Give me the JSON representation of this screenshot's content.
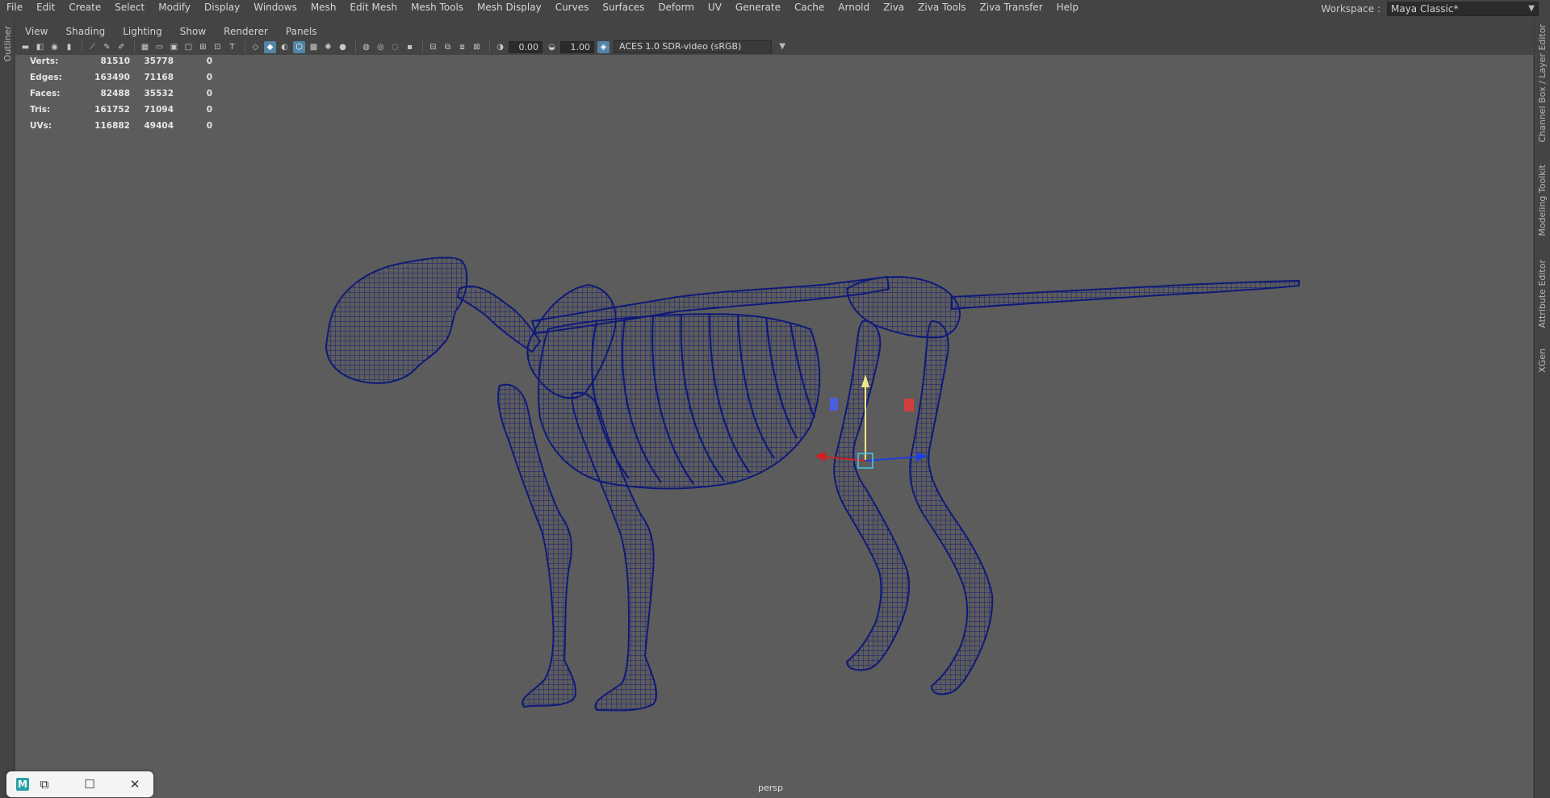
{
  "menu": [
    "File",
    "Edit",
    "Create",
    "Select",
    "Modify",
    "Display",
    "Windows",
    "Mesh",
    "Edit Mesh",
    "Mesh Tools",
    "Mesh Display",
    "Curves",
    "Surfaces",
    "Deform",
    "UV",
    "Generate",
    "Cache",
    "Arnold",
    "Ziva",
    "Ziva Tools",
    "Ziva Transfer",
    "Help"
  ],
  "workspace": {
    "label": "Workspace :",
    "value": "Maya Classic*"
  },
  "left_tabs": {
    "outliner": "Outliner"
  },
  "right_tabs": {
    "channel_box": "Channel Box / Layer Editor",
    "modeling_toolkit": "Modeling Toolkit",
    "attribute_editor": "Attribute Editor",
    "xgen": "XGen"
  },
  "panel_menu": [
    "View",
    "Shading",
    "Lighting",
    "Show",
    "Renderer",
    "Panels"
  ],
  "toolbar": {
    "exposure": "0.00",
    "gamma": "1.00",
    "color_space": "ACES 1.0 SDR-video (sRGB)"
  },
  "hud": {
    "verts": {
      "label": "Verts:",
      "c1": "81510",
      "c2": "35778",
      "c3": "0"
    },
    "edges": {
      "label": "Edges:",
      "c1": "163490",
      "c2": "71168",
      "c3": "0"
    },
    "faces": {
      "label": "Faces:",
      "c1": "82488",
      "c2": "35532",
      "c3": "0"
    },
    "tris": {
      "label": "Tris:",
      "c1": "161752",
      "c2": "71094",
      "c3": "0"
    },
    "uvs": {
      "label": "UVs:",
      "c1": "116882",
      "c2": "49404",
      "c3": "0"
    }
  },
  "camera": "persp",
  "colors": {
    "wireframe": "#0f1a78",
    "viewport_bg": "#5c5c5c",
    "ui_bg": "#444444",
    "accent": "#5285a6"
  }
}
